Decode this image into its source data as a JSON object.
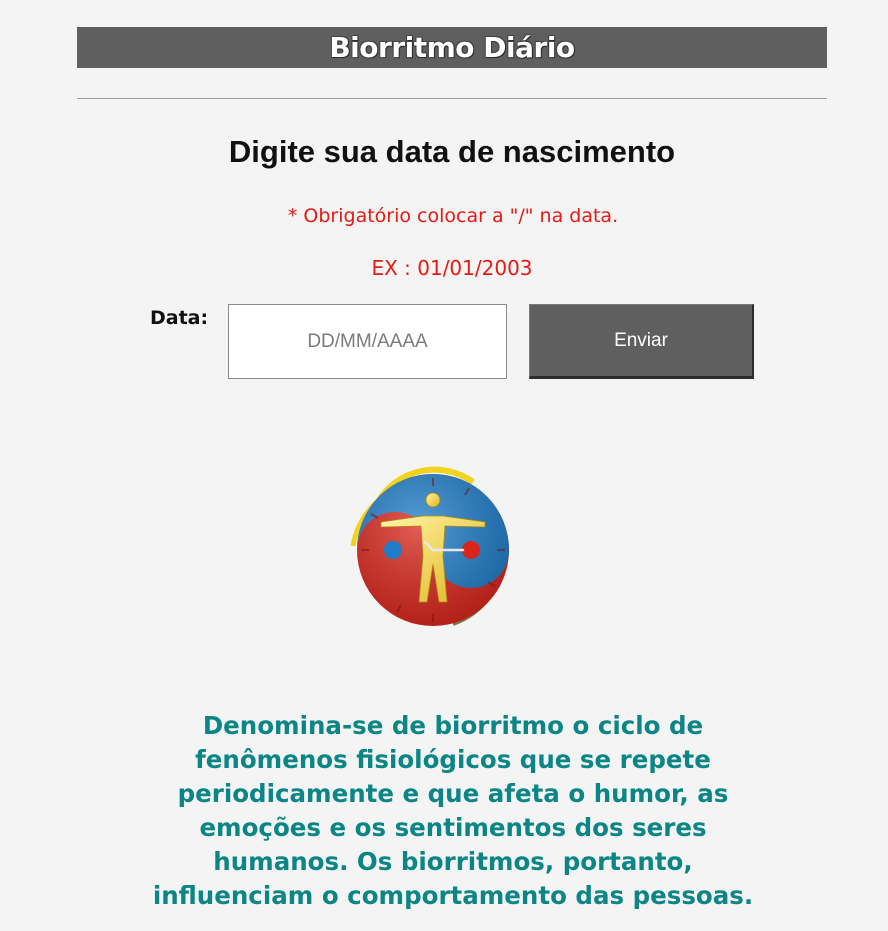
{
  "header": {
    "title": "Biorritmo Diário"
  },
  "form": {
    "heading": "Digite sua data de nascimento",
    "required_note": "* Obrigatório colocar a \"/\" na data.",
    "example": "EX : 01/01/2003",
    "date_label": "Data:",
    "date_value": "",
    "date_placeholder": "DD/MM/AAAA",
    "submit_label": "Enviar"
  },
  "logo": {
    "icon": "biorhythm-yin-yang-human-figure-icon",
    "colors": {
      "red": "#d9261c",
      "blue": "#1f7dc8",
      "gold": "#f0c419"
    }
  },
  "description": "Denomina-se de biorritmo o ciclo de fenômenos fisiológicos que se repete periodicamente e que afeta o humor, as emoções e os sentimentos dos seres humanos. Os biorritmos, portanto, influenciam o comportamento das pessoas.",
  "colors": {
    "header_bg": "#5f5f5f",
    "page_bg": "#f4f4f4",
    "required_text": "#e41b14",
    "description_text": "#0b8585",
    "button_bg": "#5f5f5f"
  }
}
